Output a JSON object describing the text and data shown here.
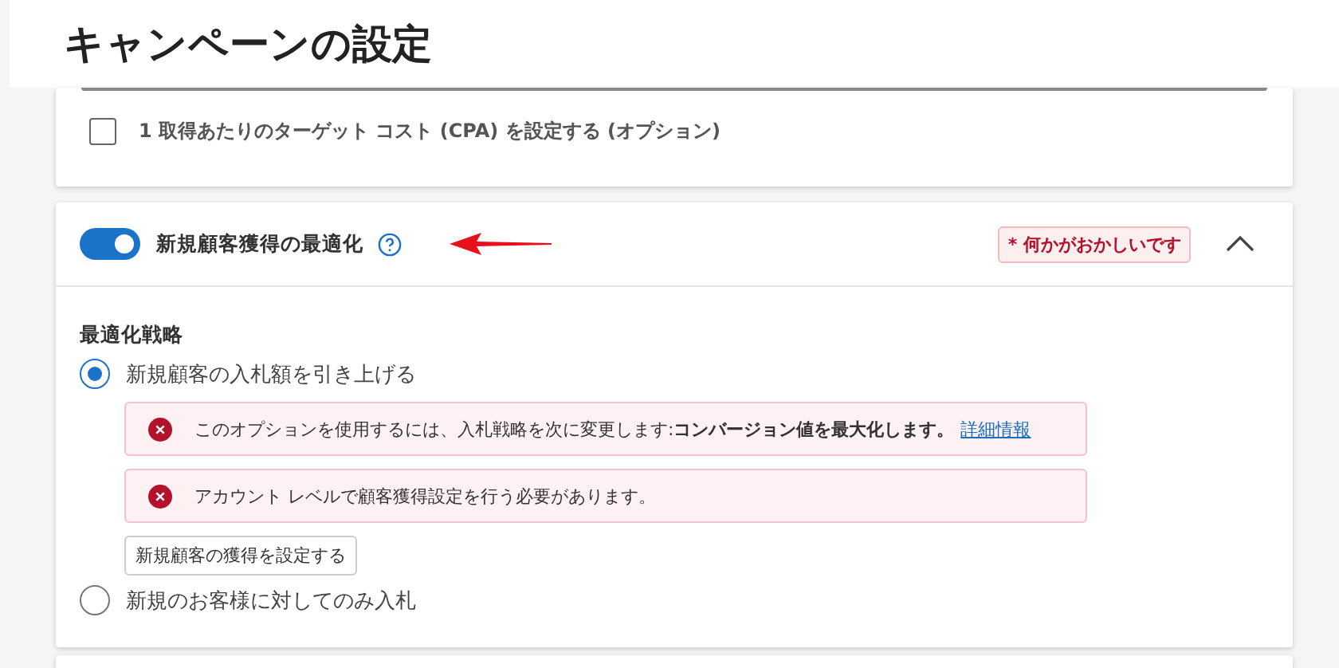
{
  "title": "キャンペーンの設定",
  "cpa_option": {
    "label": "1 取得あたりのターゲット コスト (CPA) を設定する (オプション)",
    "checked": false
  },
  "section": {
    "title": "新規顧客獲得の最適化",
    "on": true,
    "expanded": true,
    "warning_badge": "* 何かがおかしいです",
    "strategy_label": "最適化戦略",
    "options": [
      {
        "label": "新規顧客の入札額を引き上げる",
        "selected": true,
        "errors": [
          {
            "text": "このオプションを使用するには、入札戦略を次に変更します:**コンバージョン値を最大化します。**",
            "link": "詳細情報"
          },
          {
            "text": "アカウント レベルで顧客獲得設定を行う必要があります。"
          }
        ],
        "button": "新規顧客の獲得を設定する"
      },
      {
        "label": "新規のお客様に対してのみ入札",
        "selected": false
      }
    ]
  }
}
